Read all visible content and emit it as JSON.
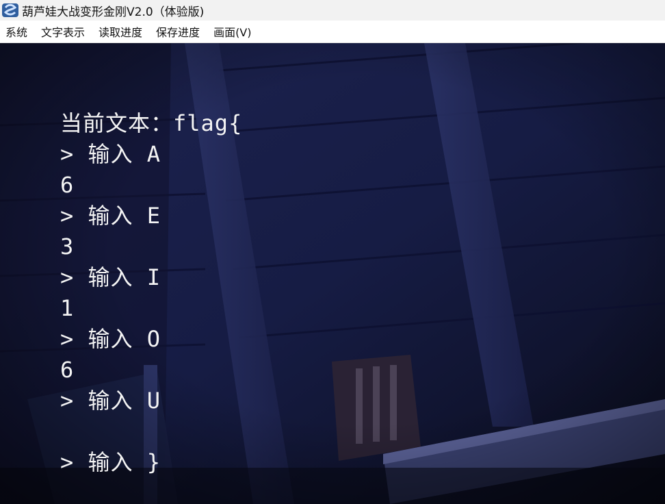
{
  "window": {
    "title": "葫芦娃大战变形金刚V2.0（体验版)",
    "icon": "snake-app-icon"
  },
  "menu": {
    "items": [
      "系统",
      "文字表示",
      "读取进度",
      "保存进度",
      "画面(V)"
    ]
  },
  "console": {
    "lines": [
      "当前文本：flag{",
      "> 输入 A",
      "6",
      "> 输入 E",
      "3",
      "> 输入 I",
      "1",
      "> 输入 O",
      "6",
      "> 输入 U",
      "",
      "> 输入 }"
    ]
  },
  "colors": {
    "scene_background": "#141a3a",
    "text": "#f4f4f4"
  }
}
